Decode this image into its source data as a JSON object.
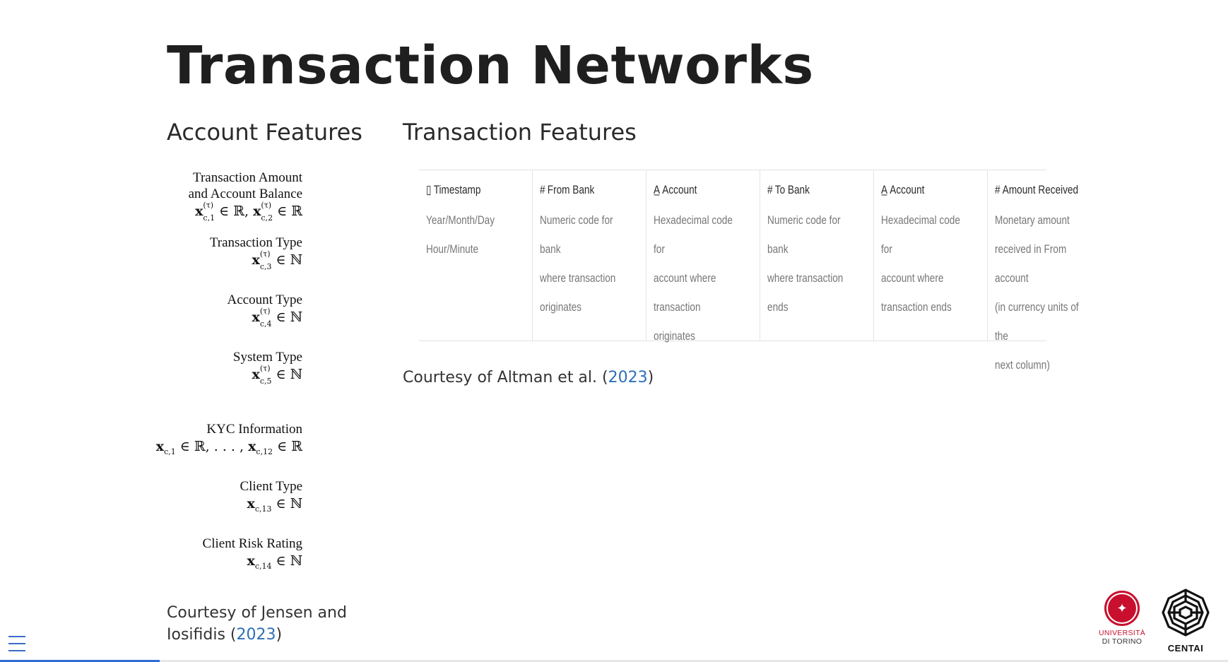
{
  "slide": {
    "title": "Transaction Networks"
  },
  "account_features": {
    "heading": "Account Features",
    "items": [
      {
        "label_line1": "Transaction Amount",
        "label_line2": "and Account Balance",
        "math": "x(τ)c,1 ∈ ℝ, x(τ)c,2 ∈ ℝ"
      },
      {
        "label_line1": "Transaction Type",
        "label_line2": "",
        "math": "x(τ)c,3 ∈ ℕ"
      },
      {
        "label_line1": "Account Type",
        "label_line2": "",
        "math": "x(τ)c,4 ∈ ℕ"
      },
      {
        "label_line1": "System Type",
        "label_line2": "",
        "math": "x(τ)c,5 ∈ ℕ"
      },
      {
        "label_line1": "KYC Information",
        "label_line2": "",
        "math": "xc,1 ∈ ℝ, . . . , xc,12 ∈ ℝ"
      },
      {
        "label_line1": "Client Type",
        "label_line2": "",
        "math": "xc,13 ∈ ℕ"
      },
      {
        "label_line1": "Client Risk Rating",
        "label_line2": "",
        "math": "xc,14 ∈ ℕ"
      }
    ],
    "courtesy_text": "Courtesy of Jensen and Iosifidis (",
    "courtesy_year": "2023",
    "courtesy_close": ")"
  },
  "transaction_features": {
    "heading": "Transaction Features",
    "columns": [
      {
        "icon": "calendar-icon",
        "header": "Timestamp",
        "description": "Year/Month/Day\nHour/Minute"
      },
      {
        "icon": "hash-icon",
        "header": "From Bank",
        "description": "Numeric code for bank\nwhere transaction\noriginates"
      },
      {
        "icon": "text-type-icon",
        "header": "Account",
        "description": "Hexadecimal code for\naccount where\ntransaction originates"
      },
      {
        "icon": "hash-icon",
        "header": "To Bank",
        "description": "Numeric code for bank\nwhere transaction ends"
      },
      {
        "icon": "text-type-icon",
        "header": "Account",
        "description": "Hexadecimal code for\naccount where\ntransaction ends"
      },
      {
        "icon": "hash-icon",
        "header": "Amount Received",
        "description": "Monetary amount\nreceived in From account\n(in currency units of the\nnext column)"
      }
    ],
    "courtesy_text": "Courtesy of Altman et al. (",
    "courtesy_year": "2023",
    "courtesy_close": ")"
  },
  "footer": {
    "unito_line1": "UNIVERSITÀ",
    "unito_line2": "DI TORINO",
    "centai_label": "CENTAI",
    "progress_fraction": 0.13,
    "progress_color": "#2f6dd4"
  }
}
